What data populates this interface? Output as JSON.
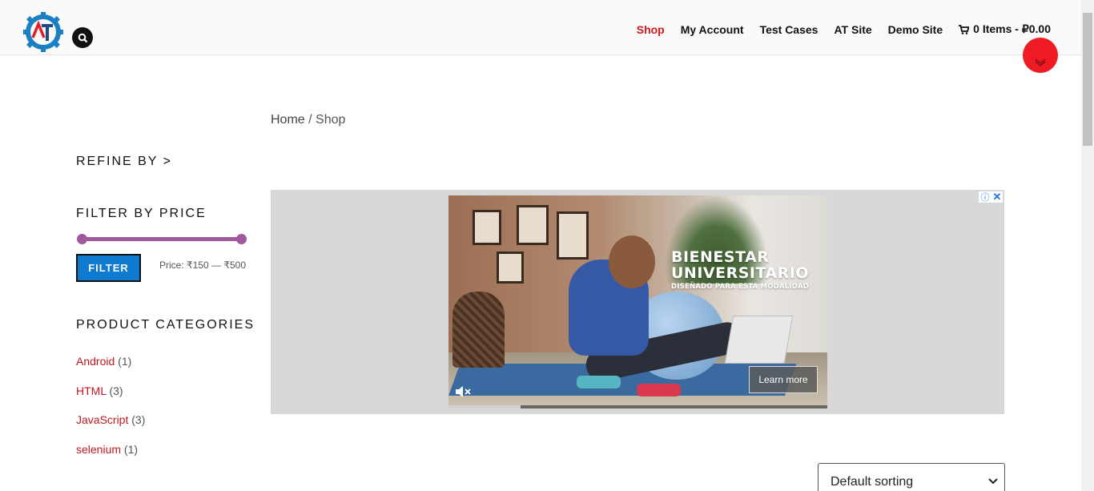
{
  "header": {
    "nav": [
      {
        "label": "Shop",
        "active": true
      },
      {
        "label": "My Account"
      },
      {
        "label": "Test Cases"
      },
      {
        "label": "AT Site"
      },
      {
        "label": "Demo Site"
      }
    ],
    "cart_label": "0 Items - ₽0.00",
    "icons": [
      "logo-gear-icon",
      "search-icon",
      "cart-icon"
    ]
  },
  "breadcrumb": {
    "home": "Home",
    "separator": " / ",
    "current": "Shop"
  },
  "sidebar": {
    "refine_heading": "REFINE BY >",
    "price_heading": "FILTER BY PRICE",
    "filter_button": "FILTER",
    "price_label": "Price: ₹150 — ₹500",
    "price_range": {
      "min": 150,
      "max": 500
    },
    "slider_level": {
      "low": 0,
      "high": 1
    },
    "categories_heading": "PRODUCT CATEGORIES",
    "categories": [
      {
        "name": "Android",
        "count": "(1)"
      },
      {
        "name": "HTML",
        "count": "(3)"
      },
      {
        "name": "JavaScript",
        "count": "(3)"
      },
      {
        "name": "selenium",
        "count": "(1)"
      }
    ]
  },
  "ad": {
    "headline_1": "BIENESTAR",
    "headline_2": "UNIVERSITARIO",
    "tagline": "DISEÑADO PARA ESTA MODALIDAD",
    "cta": "Learn more",
    "info_icon": "ⓘ",
    "close_icon": "✕",
    "progress_fraction": 0.19
  },
  "sorting": {
    "selected": "Default sorting"
  },
  "colors": {
    "accent_red": "#d01920",
    "filter_blue": "#0f7bd0",
    "slider_purple": "#a0599c"
  }
}
